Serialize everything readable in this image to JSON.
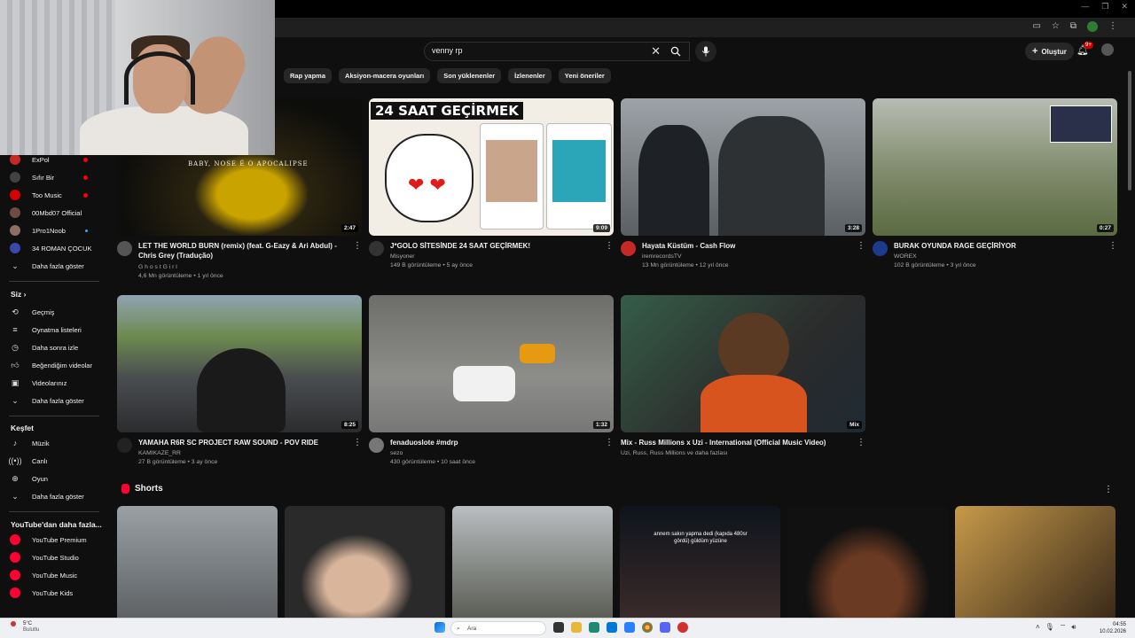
{
  "search": {
    "query": "venny rp"
  },
  "header": {
    "create_label": "Oluştur",
    "notif_badge": "9+"
  },
  "chips": [
    "Rap yapma",
    "Aksiyon-macera oyunları",
    "Son yüklenenler",
    "İzlenenler",
    "Yeni öneriler"
  ],
  "sidebar": {
    "subscriptions": [
      {
        "label": "ExPol",
        "status": "live",
        "color": "#c62828"
      },
      {
        "label": "Sıfır Bir",
        "status": "live",
        "color": "#424242"
      },
      {
        "label": "Too Music",
        "status": "live",
        "color": "#d50000"
      },
      {
        "label": "00Mbd07 Official",
        "status": "",
        "color": "#6d4c41"
      },
      {
        "label": "1Pro1Noob",
        "status": "new",
        "color": "#8d6e63"
      },
      {
        "label": "34 ROMAN ÇOCUK...",
        "status": "",
        "color": "#3949ab"
      }
    ],
    "show_more_1": "Daha fazla göster",
    "you_header": "Siz",
    "you_items": [
      "Geçmiş",
      "Oynatma listeleri",
      "Daha sonra izle",
      "Beğendiğim videolar",
      "Videolarınız"
    ],
    "show_more_2": "Daha fazla göster",
    "explore_header": "Keşfet",
    "explore_items": [
      "Müzik",
      "Canlı",
      "Oyun"
    ],
    "show_more_3": "Daha fazla göster",
    "more_header": "YouTube'dan daha fazla...",
    "more_items": [
      "YouTube Premium",
      "YouTube Studio",
      "YouTube Music",
      "YouTube Kids"
    ]
  },
  "videos": [
    {
      "title": "LET THE WORLD BURN (remix) (feat. G-Eazy & Ari Abdul) - Chris Grey (Tradução)",
      "channel": "G h o s t G i r l",
      "stats": "4,6 Mn görüntüleme • 1 yıl önce",
      "duration": "2:47",
      "thumb_color": "#1b1b12",
      "av_color": "#555"
    },
    {
      "title": "J*GOLO SİTESİNDE 24 SAAT GEÇİRMEK!",
      "channel": "Misyoner",
      "stats": "149 B görüntüleme • 5 ay önce",
      "duration": "9:09",
      "thumb_color": "#f2eee6",
      "av_color": "#333",
      "thumb_text": "24 SAAT GEÇİRMEK"
    },
    {
      "title": "Hayata Küstüm - Cash Flow",
      "channel": "iremrecordsTV",
      "stats": "13 Mn görüntüleme • 12 yıl önce",
      "duration": "3:28",
      "thumb_color": "#6b6f75",
      "av_color": "#c62828"
    },
    {
      "title": "BURAK OYUNDA RAGE GEÇİRİYOR",
      "channel": "WOREX",
      "stats": "102 B görüntüleme • 3 yıl önce",
      "duration": "0:27",
      "thumb_color": "#7c8a6e",
      "av_color": "#1e3a8a"
    },
    {
      "title": "YAMAHA R6R SC PROJECT RAW SOUND - POV RIDE",
      "channel": "KAMIKAZE_RR",
      "stats": "27 B görüntüleme • 3 ay önce",
      "duration": "8:25",
      "thumb_color": "#6a7a62",
      "av_color": "#222"
    },
    {
      "title": "fenaduoslote #mdrp",
      "channel": "sezo",
      "stats": "430 görüntüleme • 10 saat önce",
      "duration": "1:32",
      "thumb_color": "#7d7f7c",
      "av_color": "#777"
    },
    {
      "title": "Mix - Russ Millions x Uzi - International (Official Music Video)",
      "channel": "Uzi, Russ, Russ Millions ve daha fazlası",
      "stats": "",
      "duration": "Mix",
      "thumb_color": "#2b4a3b",
      "av_color": ""
    }
  ],
  "shorts": {
    "label": "Shorts",
    "items": [
      {
        "color": "#7a7d80"
      },
      {
        "color": "#2a2a2a"
      },
      {
        "color": "#8a8f93"
      },
      {
        "color": "#16202a",
        "caption": "annem sakın yapma dedi (kapıda 480sr gördü) güldüm yüzüne"
      },
      {
        "color": "#1a1a1a"
      },
      {
        "color": "#5a4a30"
      }
    ]
  },
  "taskbar": {
    "temp": "5°C",
    "weather": "Bulutlu",
    "search_placeholder": "Ara",
    "time": "04:55",
    "date": "10.02.2026"
  }
}
